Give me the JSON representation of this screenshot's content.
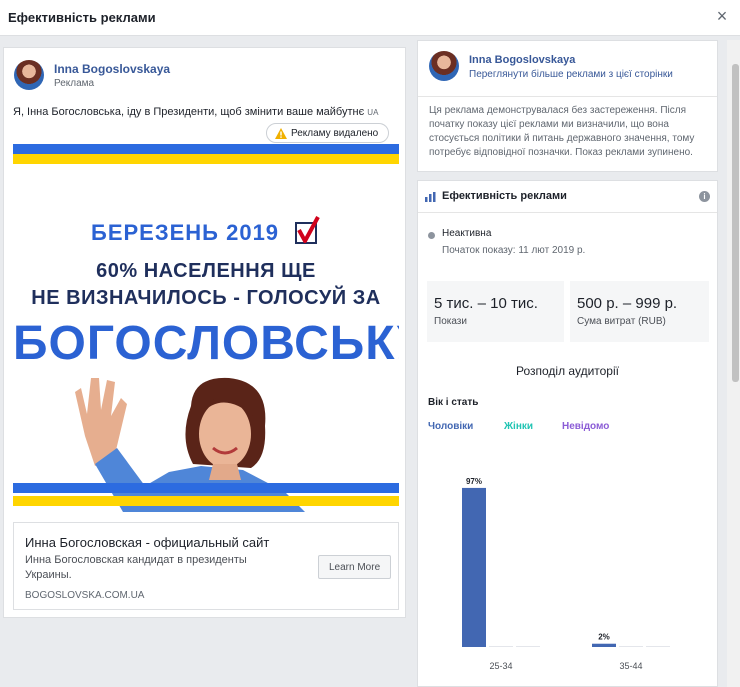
{
  "window": {
    "title": "Ефективність реклами",
    "close_label": "×"
  },
  "ad": {
    "page_name": "Inna Bogoslovskaya",
    "sponsored_label": "Реклама",
    "text": "Я, Інна Богословська, іду в Президенти, щоб змінити ваше майбутнє",
    "text_suffix": "UA",
    "removed_label": "Рекламу видалено",
    "creative": {
      "month": "БЕРЕЗЕНЬ 2019",
      "line1": "60% НАСЕЛЕННЯ ЩЕ",
      "line2": "НЕ ВИЗНАЧИЛОСЬ - ГОЛОСУЙ ЗА",
      "name": "БОГОСЛОВСЬКУ",
      "colors": {
        "blue": "#2c6be0",
        "yellow": "#ffd500",
        "check": "#d0021b"
      }
    },
    "link": {
      "title": "Инна Богословская - официальный сайт",
      "description": "Инна Богословская кандидат в президенты Украины.",
      "domain": "BOGOSLOVSKA.COM.UA",
      "cta": "Learn More"
    }
  },
  "page_panel": {
    "name": "Inna Bogoslovskaya",
    "more_ads_link": "Переглянути більше реклами з цієї сторінки",
    "disclaimer": "Ця реклама демонструвалася без застереження. Після початку показу цієї реклами ми визначили, що вона стосується політики й питань державного значення, тому потребує відповідної позначки. Показ реклами зупинено."
  },
  "performance": {
    "title": "Ефективність реклами",
    "info_icon": "i",
    "status": "Неактивна",
    "start": "Початок показу: 11 лют 2019 р.",
    "impressions": {
      "value": "5 тис. – 10 тис.",
      "label": "Покази"
    },
    "spend": {
      "value": "500 р. – 999 р.",
      "label": "Сума витрат (RUB)"
    },
    "audience_title": "Розподіл аудиторії",
    "age_gender_title": "Вік і стать",
    "legend": {
      "men": "Чоловіки",
      "women": "Жінки",
      "unknown": "Невідомо"
    }
  },
  "chart_data": {
    "type": "bar",
    "categories": [
      "25-34",
      "35-44"
    ],
    "series": [
      {
        "name": "Чоловіки",
        "values": [
          97,
          2
        ],
        "labels": [
          "97%",
          "2%"
        ]
      },
      {
        "name": "Жінки",
        "values": [
          0,
          0
        ]
      },
      {
        "name": "Невідомо",
        "values": [
          0,
          0
        ]
      }
    ],
    "ylim": [
      0,
      100
    ],
    "colors": [
      "#4267b2",
      "#20c4b3",
      "#8b5cd6"
    ]
  }
}
